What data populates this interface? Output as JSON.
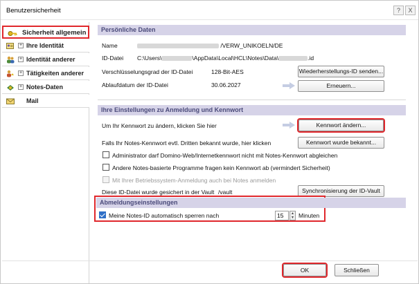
{
  "window": {
    "title": "Benutzersicherheit",
    "help_label": "?",
    "close_label": "X"
  },
  "sidebar": {
    "items": [
      {
        "label": "Sicherheit allgemein",
        "icon": "key-icon"
      },
      {
        "label": "Ihre Identität",
        "icon": "id-card-icon"
      },
      {
        "label": "Identität anderer",
        "icon": "people-icon"
      },
      {
        "label": "Tätigkeiten anderer",
        "icon": "activity-icon"
      },
      {
        "label": "Notes-Daten",
        "icon": "database-icon"
      },
      {
        "label": "Mail",
        "icon": "mail-icon"
      }
    ],
    "expand_glyph": "+"
  },
  "personal": {
    "header": "Persönliche Daten",
    "name_label": "Name",
    "name_value": "/VERW_UNIKOELN/DE",
    "iddatei_label": "ID-Datei",
    "iddatei_prefix": "C:\\Users\\",
    "iddatei_mid": "\\AppData\\Local\\HCL\\Notes\\Data\\",
    "iddatei_suffix": ".id",
    "encryption_label": "Verschlüsselungsgrad der ID-Datei",
    "encryption_value": "128-Bit-AES",
    "expiry_label": "Ablaufdatum der ID-Datei",
    "expiry_value": "30.06.2027",
    "send_recovery_button": "Wiederherstellungs-ID senden...",
    "renew_button": "Erneuern..."
  },
  "login": {
    "header": "Ihre Einstellungen zu Anmeldung und Kennwort",
    "change_pw_text": "Um Ihr Kennwort zu ändern, klicken Sie hier",
    "change_pw_button": "Kennwort ändern...",
    "known_text": "Falls Ihr Notes-Kennwort evtl. Dritten bekannt wurde, hier klicken",
    "known_button": "Kennwort wurde bekannt...",
    "checkbox_admin": "Administrator darf Domino-Web/Internetkennwort nicht mit Notes-Kennwort abgleichen",
    "checkbox_other_programs": "Andere Notes-basierte Programme fragen kein Kennwort ab (vermindert Sicherheit)",
    "checkbox_os_login": "Mit Ihrer Betriebssystem-Anmeldung auch bei Notes anmelden",
    "vault_text": "Diese ID-Datei wurde gesichert in der Vault",
    "vault_value": "/vault",
    "vault_button": "Synchronisierung der ID-Vault"
  },
  "logout": {
    "header": "Abmeldungseinstellungen",
    "lock_label": "Meine Notes-ID automatisch sperren nach",
    "lock_value": "15",
    "unit": "Minuten",
    "spin_up": "▲",
    "spin_down": "▼"
  },
  "footer": {
    "ok_button": "OK",
    "close_button": "Schließen"
  },
  "colors": {
    "section_header_bg": "#d6d3e8",
    "highlight": "#e0262b",
    "checkbox_checked": "#2f6fc7"
  }
}
